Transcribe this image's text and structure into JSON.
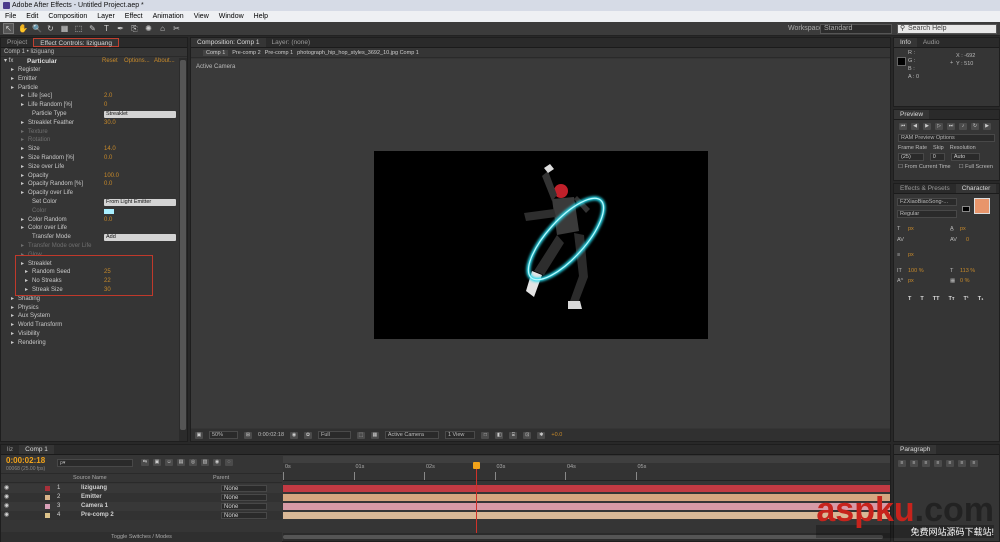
{
  "window": {
    "title": "Adobe After Effects - Untitled Project.aep *"
  },
  "menu": [
    "File",
    "Edit",
    "Composition",
    "Layer",
    "Effect",
    "Animation",
    "View",
    "Window",
    "Help"
  ],
  "toolbar": {
    "workspace_label": "Workspace:",
    "workspace_value": "Standard",
    "search_placeholder": "Search Help",
    "tools": [
      "↖",
      "✋",
      "🔍",
      "↻",
      "▦",
      "⬚",
      "✎",
      "T",
      "✒",
      "⎘",
      "✺",
      "⌂",
      "✂"
    ]
  },
  "project_panel": {
    "tab_project": "Project",
    "tab_effect": "Effect Controls: liziguang",
    "breadcrumb": "Comp 1 • liziguang"
  },
  "effect": {
    "name": "Particular",
    "reset": "Reset",
    "options": "Options...",
    "about": "About...",
    "rows": [
      {
        "label": "Register",
        "indent": 1
      },
      {
        "label": "Emitter",
        "indent": 1
      },
      {
        "label": "Particle",
        "indent": 1
      },
      {
        "label": "Life [sec]",
        "indent": 2,
        "value": "2.0"
      },
      {
        "label": "Life Random [%]",
        "indent": 2,
        "value": "0"
      },
      {
        "label": "Particle Type",
        "indent": 3,
        "select": "Streaklet"
      },
      {
        "label": "Streaklet Feather",
        "indent": 2,
        "value": "30.0"
      },
      {
        "label": "Texture",
        "indent": 2,
        "dim": true
      },
      {
        "label": "Rotation",
        "indent": 2,
        "dim": true
      },
      {
        "label": "Size",
        "indent": 2,
        "value": "14.0"
      },
      {
        "label": "Size Random [%]",
        "indent": 2,
        "value": "0.0"
      },
      {
        "label": "Size over Life",
        "indent": 2
      },
      {
        "label": "Opacity",
        "indent": 2,
        "value": "100.0"
      },
      {
        "label": "Opacity Random [%]",
        "indent": 2,
        "value": "0.0"
      },
      {
        "label": "Opacity over Life",
        "indent": 2
      },
      {
        "label": "Set Color",
        "indent": 3,
        "select": "From Light Emitter"
      },
      {
        "label": "Color",
        "indent": 3,
        "dim": true,
        "swatch": true
      },
      {
        "label": "Color Random",
        "indent": 2,
        "value": "0.0"
      },
      {
        "label": "Color over Life",
        "indent": 2
      },
      {
        "label": "Transfer Mode",
        "indent": 3,
        "select": "Add"
      },
      {
        "label": "Transfer Mode over Life",
        "indent": 2,
        "dim": true
      },
      {
        "label": "Glow",
        "indent": 2,
        "dim": true
      },
      {
        "label": "Streaklet",
        "indent": 2
      },
      {
        "label": "Random Seed",
        "indent": 3,
        "value": "25"
      },
      {
        "label": "No Streaks",
        "indent": 3,
        "value": "22"
      },
      {
        "label": "Streak Size",
        "indent": 3,
        "value": "30"
      },
      {
        "label": "Shading",
        "indent": 1
      },
      {
        "label": "Physics",
        "indent": 1
      },
      {
        "label": "Aux System",
        "indent": 1
      },
      {
        "label": "World Transform",
        "indent": 1
      },
      {
        "label": "Visibility",
        "indent": 1
      },
      {
        "label": "Rendering",
        "indent": 1
      }
    ]
  },
  "composition": {
    "tab": "Composition: Comp 1",
    "layer_tab": "Layer: (none)",
    "breadcrumbs": [
      "Comp 1",
      "Pre-comp 2",
      "Pre-comp 1",
      "photograph_hip_hop_styles_3692_10.jpg Comp 1"
    ],
    "camera_label": "Active Camera",
    "footer": {
      "zoom": "50%",
      "time": "0:00:02:18",
      "quality": "Full",
      "camera": "Active Camera",
      "views": "1 View",
      "exposure": "+0.0"
    }
  },
  "info": {
    "tab_info": "Info",
    "tab_audio": "Audio",
    "r": "R :",
    "g": "G :",
    "b": "B :",
    "a": "A : 0",
    "x": "X : -692",
    "y": "Y : 510"
  },
  "preview": {
    "title": "Preview",
    "ram": "RAM Preview Options",
    "frame_rate_label": "Frame Rate",
    "skip_label": "Skip",
    "res_label": "Resolution",
    "frame_rate": "(25)",
    "skip": "0",
    "resolution": "Auto",
    "from_current": "From Current Time",
    "full_screen": "Full Screen"
  },
  "character": {
    "tab_effects": "Effects & Presets",
    "tab_char": "Character",
    "font": "FZXiaoBiaoSong-...",
    "style": "Regular",
    "size": "px",
    "leading": "px",
    "kerning": "",
    "tracking": "0",
    "scale_v": "100 %",
    "scale_h": "113 %",
    "baseline": "px",
    "tsume": "0 %",
    "fill_color": "#e8956b"
  },
  "timeline": {
    "tab1": "liz",
    "tab2": "Comp 1",
    "time": "0:00:02:18",
    "fps": "00068 (25.00 fps)",
    "col_source": "Source Name",
    "col_parent": "Parent",
    "ticks": [
      "0s",
      "01s",
      "02s",
      "03s",
      "04s",
      "05s"
    ],
    "layers": [
      {
        "num": "1",
        "name": "liziguang",
        "color": "#a8303a",
        "parent": "None",
        "bar": "#c23a43"
      },
      {
        "num": "2",
        "name": "Emitter",
        "color": "#d9b48a",
        "parent": "None",
        "bar": "#d5a680"
      },
      {
        "num": "3",
        "name": "Camera 1",
        "color": "#d9a0b8",
        "parent": "None",
        "bar": "#d79aa6"
      },
      {
        "num": "4",
        "name": "Pre-comp 2",
        "color": "#dcc28a",
        "parent": "None",
        "bar": "#d9b896"
      }
    ],
    "toggle_label": "Toggle Switches / Modes"
  },
  "paragraph": {
    "tab": "Paragraph"
  },
  "watermark": {
    "brand": "aspku",
    "tld": ".com",
    "sub": "免费网站源码下载站!"
  },
  "colors": {
    "accent": "#f2a31a",
    "stamp_red": "#c7231c",
    "highlight_box": "#c0392b"
  }
}
